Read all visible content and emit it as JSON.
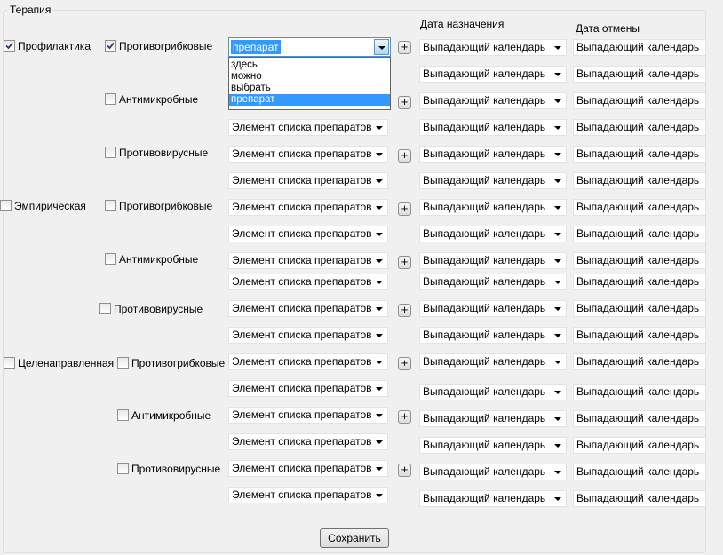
{
  "group_title": "Терапия",
  "headers": {
    "start_date": "Дата назначения",
    "end_date": "Дата отмены"
  },
  "categories": {
    "prophylaxis": "Профилактика",
    "empiric": "Эмпирическая",
    "targeted": "Целенаправленная"
  },
  "drug_types": {
    "antifungal": "Противогрибковые",
    "antimicrobial": "Антимикробные",
    "antiviral": "Противовирусные"
  },
  "drug_placeholder": "Элемент списка препаратов",
  "date_placeholder": "Выпадающий календарь",
  "plus_label": "+",
  "active_combo": {
    "value": "препарат",
    "options": [
      "здесь",
      "можно",
      "выбрать",
      "препарат"
    ]
  },
  "save_label": "Сохранить",
  "state": {
    "prophylaxis_checked": true,
    "antifungal_checked": true
  },
  "colors": {
    "window_bg": "#f0f0f0",
    "selection": "#3399ff",
    "focus_border": "#5a8fc5"
  },
  "icons": {
    "checkmark": "check-icon",
    "dropdown": "chevron-down-icon"
  }
}
